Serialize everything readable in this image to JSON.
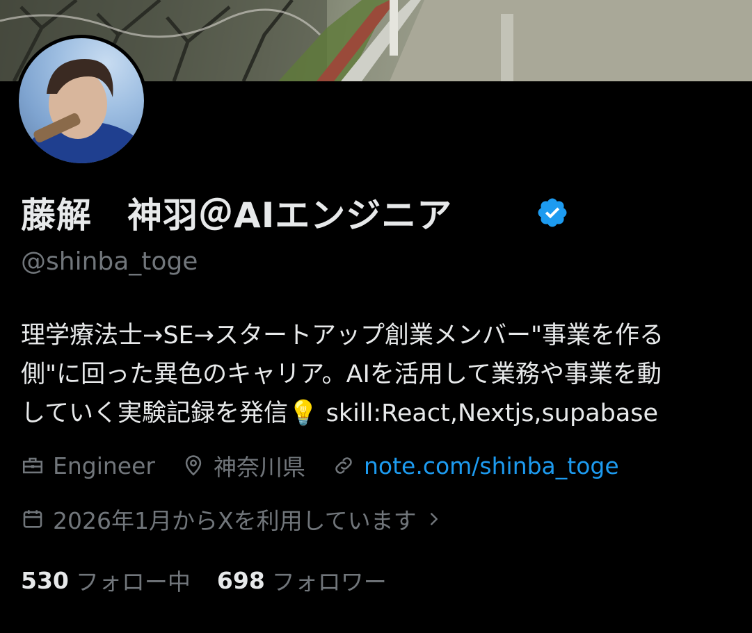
{
  "profile": {
    "display_name": "藤解　神羽＠AIエンジニア",
    "handle": "@shinba_toge",
    "verified": true,
    "bio": [
      "理学療法士→SE→スタートアップ創業メンバー\"事業を作る",
      "側\"に回った異色のキャリア。AIを活用して業務や事業を動",
      "していく実験記録を発信💡 skill:React,Nextjs,supabase"
    ],
    "profession": "Engineer",
    "location": "神奈川県",
    "website": "note.com/shinba_toge",
    "joined": "2026年1月からXを利用しています",
    "following_count": "530",
    "following_label": "フォロー中",
    "followers_count": "698",
    "followers_label": "フォロワー"
  },
  "icons": {
    "profession": "briefcase-icon",
    "location": "map-pin-icon",
    "website": "link-icon",
    "joined": "calendar-icon",
    "joined_more": "chevron-right-icon",
    "verified": "verified-badge-icon"
  },
  "colors": {
    "background": "#000000",
    "text_primary": "#e7e9ea",
    "text_secondary": "#71767b",
    "accent": "#1d9bf0"
  }
}
